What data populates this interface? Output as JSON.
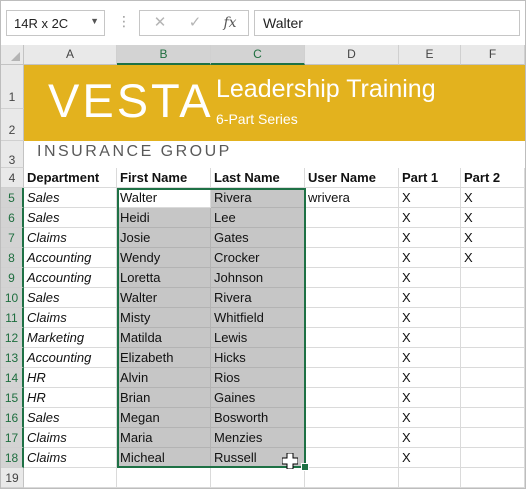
{
  "formula_bar": {
    "name_box": "14R x 2C",
    "cancel_icon": "✕",
    "enter_icon": "✓",
    "fx_label": "fx",
    "formula_value": "Walter"
  },
  "columns": [
    "A",
    "B",
    "C",
    "D",
    "E",
    "F"
  ],
  "rows": [
    "1",
    "2",
    "3",
    "4",
    "5",
    "6",
    "7",
    "8",
    "9",
    "10",
    "11",
    "12",
    "13",
    "14",
    "15",
    "16",
    "17",
    "18",
    "19"
  ],
  "banner": {
    "logo_text": "VESTA",
    "title": "Leadership Training",
    "subtitle": "6-Part Series",
    "company": "INSURANCE GROUP",
    "color": "#e3b21e"
  },
  "table": {
    "headers": [
      "Department",
      "First Name",
      "Last Name",
      "User Name",
      "Part 1",
      "Part 2"
    ],
    "rows": [
      [
        "Sales",
        "Walter",
        "Rivera",
        "wrivera",
        "X",
        "X"
      ],
      [
        "Sales",
        "Heidi",
        "Lee",
        "",
        "X",
        "X"
      ],
      [
        "Claims",
        "Josie",
        "Gates",
        "",
        "X",
        "X"
      ],
      [
        "Accounting",
        "Wendy",
        "Crocker",
        "",
        "X",
        "X"
      ],
      [
        "Accounting",
        "Loretta",
        "Johnson",
        "",
        "X",
        ""
      ],
      [
        "Sales",
        "Walter",
        "Rivera",
        "",
        "X",
        ""
      ],
      [
        "Claims",
        "Misty",
        "Whitfield",
        "",
        "X",
        ""
      ],
      [
        "Marketing",
        "Matilda",
        "Lewis",
        "",
        "X",
        ""
      ],
      [
        "Accounting",
        "Elizabeth",
        "Hicks",
        "",
        "X",
        ""
      ],
      [
        "HR",
        "Alvin",
        "Rios",
        "",
        "X",
        ""
      ],
      [
        "HR",
        "Brian",
        "Gaines",
        "",
        "X",
        ""
      ],
      [
        "Sales",
        "Megan",
        "Bosworth",
        "",
        "X",
        ""
      ],
      [
        "Claims",
        "Maria",
        "Menzies",
        "",
        "X",
        ""
      ],
      [
        "Claims",
        "Micheal",
        "Russell",
        "",
        "X",
        ""
      ]
    ]
  },
  "colors": {
    "selection_green": "#1e7145",
    "selection_fill": "#c6c6c6"
  },
  "icons": {
    "name_box_dropdown": "chevron-down-icon",
    "cancel": "close-icon",
    "enter": "check-icon",
    "function": "function-icon",
    "cursor": "fill-cross-cursor-icon"
  }
}
